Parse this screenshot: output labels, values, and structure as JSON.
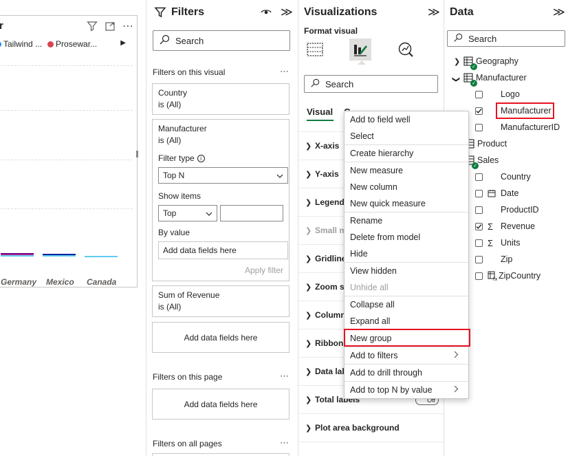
{
  "canvas": {
    "title_fragment": "r",
    "legend": [
      {
        "label": "Tailwind ...",
        "color": "#118dff"
      },
      {
        "label": "Prosewar...",
        "color": "#d64550"
      }
    ],
    "x_labels": [
      "Germany",
      "Mexico",
      "Canada"
    ],
    "colors": {
      "bar_top": "#6b007b",
      "bar_mid": "#e044a7",
      "bar_base": "#12239e",
      "bar_light": "#5ecbf0"
    }
  },
  "filters": {
    "title": "Filters",
    "search_placeholder": "Search",
    "on_visual_label": "Filters on this visual",
    "cards": {
      "country": {
        "name": "Country",
        "state": "is (All)"
      },
      "manufacturer": {
        "name": "Manufacturer",
        "state": "is (All)",
        "filter_type_label": "Filter type",
        "filter_type_value": "Top N",
        "show_items_label": "Show items",
        "show_items_value": "Top",
        "by_value_label": "By value",
        "by_value_placeholder": "Add data fields here",
        "apply_label": "Apply filter"
      },
      "revenue": {
        "name": "Sum of Revenue",
        "state": "is (All)"
      }
    },
    "add_fields_visual": "Add data fields here",
    "on_page_label": "Filters on this page",
    "add_fields_page": "Add data fields here",
    "all_pages_label": "Filters on all pages"
  },
  "viz": {
    "title": "Visualizations",
    "format_visual_label": "Format visual",
    "search_placeholder": "Search",
    "tab_visual": "Visual",
    "tab_general_fragment": "G",
    "sections": [
      {
        "label": "X-axis",
        "dim": false
      },
      {
        "label": "Y-axis",
        "dim": false
      },
      {
        "label": "Legend",
        "dim": false
      },
      {
        "label": "Small m",
        "dim": true
      },
      {
        "label": "Gridline",
        "dim": false
      },
      {
        "label": "Zoom sl",
        "dim": false
      },
      {
        "label": "Column",
        "dim": false
      },
      {
        "label": "Ribbons",
        "dim": false
      },
      {
        "label": "Data lab",
        "dim": false
      },
      {
        "label": "Total labels",
        "dim": false,
        "toggle": "Off"
      },
      {
        "label": "Plot area background",
        "dim": false
      }
    ]
  },
  "data": {
    "title": "Data",
    "search_placeholder": "Search",
    "tree": [
      {
        "kind": "table",
        "label": "Geography",
        "expanded": false
      },
      {
        "kind": "table",
        "label": "Manufacturer",
        "expanded": true
      },
      {
        "kind": "field",
        "label": "Logo",
        "checked": false
      },
      {
        "kind": "field",
        "label": "Manufacturer",
        "checked": true,
        "highlighted": true
      },
      {
        "kind": "field",
        "label": "ManufacturerID",
        "checked": false
      },
      {
        "kind": "table",
        "label": "Product",
        "expanded": false
      },
      {
        "kind": "table",
        "label": "Sales",
        "expanded": true
      },
      {
        "kind": "field",
        "label": "Country",
        "checked": false
      },
      {
        "kind": "field",
        "label": "Date",
        "checked": false,
        "icon": "calendar-icon"
      },
      {
        "kind": "field",
        "label": "ProductID",
        "checked": false
      },
      {
        "kind": "field",
        "label": "Revenue",
        "checked": true,
        "icon": "sigma-icon"
      },
      {
        "kind": "field",
        "label": "Units",
        "checked": false,
        "icon": "sigma-icon"
      },
      {
        "kind": "field",
        "label": "Zip",
        "checked": false
      },
      {
        "kind": "field",
        "label": "ZipCountry",
        "checked": false,
        "icon": "calculated-icon"
      }
    ]
  },
  "context_menu": {
    "items": [
      {
        "label": "Add to field well"
      },
      {
        "label": "Select"
      },
      {
        "label": "Create hierarchy"
      },
      {
        "label": "New measure"
      },
      {
        "label": "New column"
      },
      {
        "label": "New quick measure"
      },
      {
        "label": "Rename"
      },
      {
        "label": "Delete from model"
      },
      {
        "label": "Hide"
      },
      {
        "label": "View hidden"
      },
      {
        "label": "Unhide all",
        "disabled": true
      },
      {
        "label": "Collapse all"
      },
      {
        "label": "Expand all"
      },
      {
        "label": "New group",
        "highlighted": true
      },
      {
        "label": "Add to filters",
        "submenu": true
      },
      {
        "label": "Add to drill through"
      },
      {
        "label": "Add to top N by value",
        "submenu": true
      }
    ]
  },
  "accent_color": "#107c41",
  "highlight_color": "#e81123"
}
